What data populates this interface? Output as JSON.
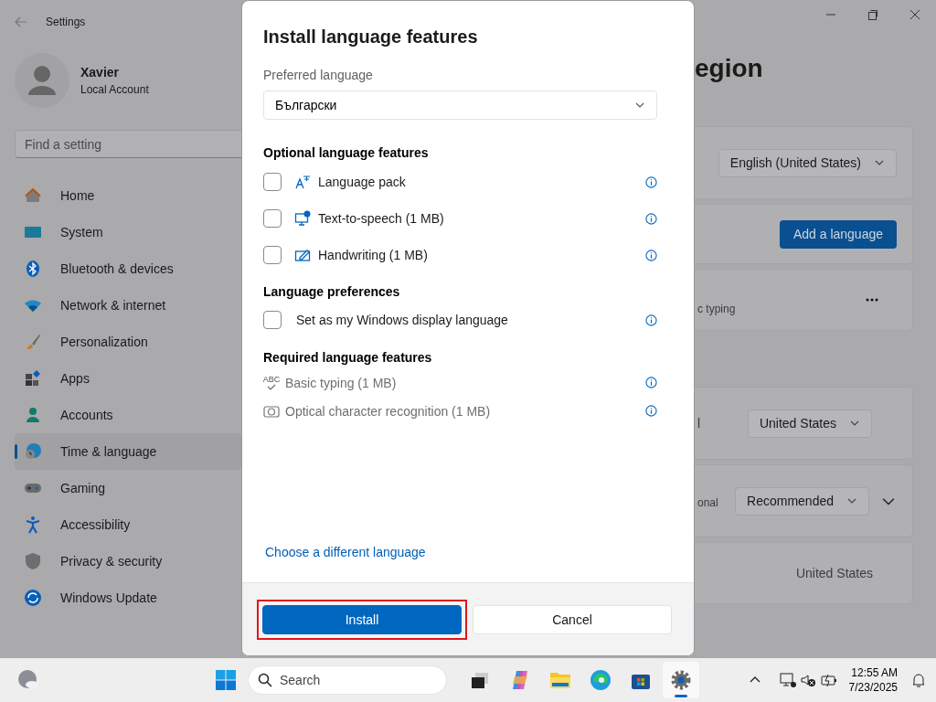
{
  "window": {
    "title": "Settings"
  },
  "user": {
    "name": "Xavier",
    "account": "Local Account"
  },
  "search": {
    "placeholder": "Find a setting"
  },
  "nav": [
    {
      "label": "Home",
      "selected": false
    },
    {
      "label": "System",
      "selected": false
    },
    {
      "label": "Bluetooth & devices",
      "selected": false
    },
    {
      "label": "Network & internet",
      "selected": false
    },
    {
      "label": "Personalization",
      "selected": false
    },
    {
      "label": "Apps",
      "selected": false
    },
    {
      "label": "Accounts",
      "selected": false
    },
    {
      "label": "Time & language",
      "selected": true
    },
    {
      "label": "Gaming",
      "selected": false
    },
    {
      "label": "Accessibility",
      "selected": false
    },
    {
      "label": "Privacy & security",
      "selected": false
    },
    {
      "label": "Windows Update",
      "selected": false
    }
  ],
  "page_title": "egion",
  "cards": [
    {
      "kind": "dropdown",
      "value": "English (United States)"
    },
    {
      "kind": "button",
      "label": "Add a language"
    },
    {
      "kind": "more",
      "text": "c typing"
    },
    {
      "kind": "dropdown",
      "text": "l",
      "value": "United States"
    },
    {
      "kind": "expander",
      "text": "onal",
      "value": "Recommended",
      "expanded": false
    },
    {
      "kind": "value",
      "value": "United States"
    }
  ],
  "dialog": {
    "title": "Install language features",
    "preferred_language": {
      "label": "Preferred language",
      "value": "Български"
    },
    "optional_features": {
      "title": "Optional language features",
      "items": [
        {
          "label": "Language pack",
          "checked": false
        },
        {
          "label": "Text-to-speech (1 MB)",
          "checked": false
        },
        {
          "label": "Handwriting (1 MB)",
          "checked": false
        }
      ]
    },
    "language_preferences": {
      "title": "Language preferences",
      "items": [
        {
          "label": "Set as my Windows display language",
          "checked": false
        }
      ]
    },
    "required_features": {
      "title": "Required language features",
      "items": [
        {
          "label": "Basic typing (1 MB)",
          "icon_text": "ABC"
        },
        {
          "label": "Optical character recognition (1 MB)"
        }
      ]
    },
    "link": "Choose a different language",
    "buttons": [
      {
        "label": "Install",
        "kind": "primary",
        "highlighted": true
      },
      {
        "label": "Cancel",
        "kind": "secondary",
        "highlighted": false
      }
    ]
  },
  "taskbar": {
    "search_placeholder": "Search",
    "apps": [
      {
        "selected": false
      },
      {
        "selected": false
      },
      {
        "selected": false
      },
      {
        "selected": false
      },
      {
        "selected": false
      },
      {
        "selected": true
      }
    ],
    "time": "12:55 AM",
    "date": "7/23/2025"
  }
}
